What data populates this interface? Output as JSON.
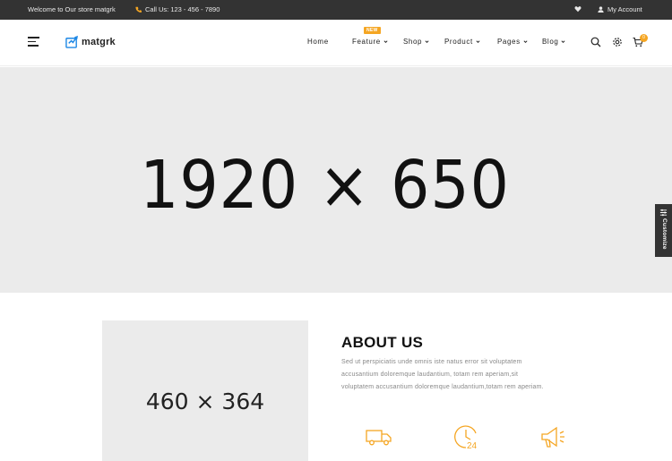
{
  "topbar": {
    "welcome": "Welcome to Our store matgrk",
    "phone": "Call Us: 123 - 456 - 7890",
    "account": "My Account"
  },
  "header": {
    "logo_text": "matgrk",
    "nav": [
      {
        "label": "Home",
        "has_dropdown": false
      },
      {
        "label": "Feature",
        "has_dropdown": true,
        "badge": "NEW"
      },
      {
        "label": "Shop",
        "has_dropdown": true
      },
      {
        "label": "Product",
        "has_dropdown": true
      },
      {
        "label": "Pages",
        "has_dropdown": true
      },
      {
        "label": "Blog",
        "has_dropdown": true
      }
    ],
    "cart_count": "0",
    "icons": [
      "search-icon",
      "gear-icon",
      "cart-icon"
    ]
  },
  "hero": {
    "placeholder": "1920 × 650",
    "background": "#ebebeb"
  },
  "customize": {
    "label": "Customize"
  },
  "about": {
    "image_placeholder": "460 × 364",
    "title": "ABOUT US",
    "lines": [
      "Sed ut perspiciatis unde omnis iste natus error sit voluptatem",
      "accusantium doloremque laudantium, totam rem aperiam,sit",
      "voluptatem accusantium doloremque laudantium,totam rem aperiam."
    ],
    "features": [
      "truck-icon",
      "clock-24-icon",
      "megaphone-icon"
    ]
  },
  "colors": {
    "topbar_bg": "#333333",
    "accent": "#f5a623",
    "text_dark": "#222222",
    "text_muted": "#888888"
  }
}
